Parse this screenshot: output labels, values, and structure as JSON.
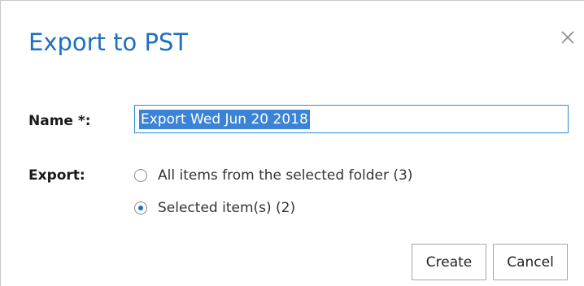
{
  "dialog": {
    "title": "Export to PST",
    "close_icon": "close-icon"
  },
  "form": {
    "name_label": "Name *:",
    "name_value": "Export Wed Jun 20 2018",
    "export_label": "Export:",
    "export_options": [
      {
        "label": "All items from the selected folder (3)",
        "selected": false
      },
      {
        "label": "Selected item(s) (2)",
        "selected": true
      }
    ]
  },
  "buttons": {
    "create_label": "Create",
    "cancel_label": "Cancel"
  },
  "colors": {
    "title": "#1f6fbf",
    "selection": "#3b83d6",
    "input_border": "#2c8ad6"
  }
}
